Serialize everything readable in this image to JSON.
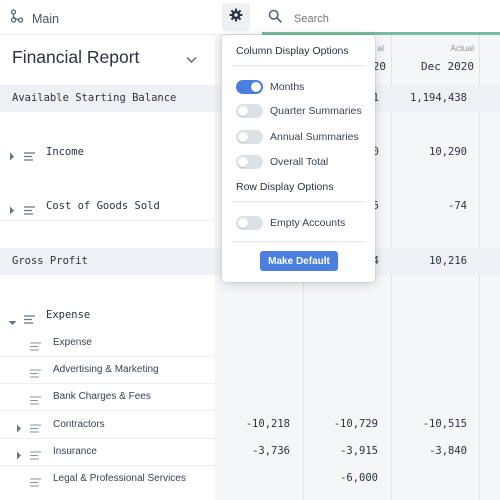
{
  "topbar": {
    "crumb_label": "Main",
    "search_placeholder": "Search",
    "accent": "#79bba0"
  },
  "report": {
    "title": "Financial Report"
  },
  "columns": [
    {
      "top": "al",
      "main": "20"
    },
    {
      "top": "Actual",
      "main": "Dec 2020"
    }
  ],
  "rows": {
    "available": {
      "label": "Available Starting Balance",
      "col_partial": "1",
      "col_last": "1,194,438"
    },
    "income": {
      "label": "Income",
      "col_partial": "0",
      "col_last": "10,290"
    },
    "cogs": {
      "label": "Cost of Goods Sold",
      "col_partial": "5",
      "col_last": "-74"
    },
    "gross": {
      "label": "Gross Profit",
      "col_partial": "4",
      "col_last": "10,216"
    },
    "expense_group": {
      "label": "Expense"
    },
    "expense": {
      "label": "Expense"
    },
    "advertising": {
      "label": "Advertising & Marketing"
    },
    "bank": {
      "label": "Bank Charges & Fees"
    },
    "contractors": {
      "label": "Contractors",
      "c1": "-10,218",
      "c2": "-10,729",
      "c3": "-10,515"
    },
    "insurance": {
      "label": "Insurance",
      "c1": "-3,736",
      "c2": "-3,915",
      "c3": "-3,840"
    },
    "legal": {
      "label": "Legal & Professional Services",
      "c2": "-6,000"
    }
  },
  "popover": {
    "column_heading": "Column Display Options",
    "row_heading": "Row Display Options",
    "toggles": [
      {
        "label": "Months",
        "on": true
      },
      {
        "label": "Quarter Summaries",
        "on": false
      },
      {
        "label": "Annual Summaries",
        "on": false
      },
      {
        "label": "Overall Total",
        "on": false
      }
    ],
    "row_toggles": [
      {
        "label": "Empty Accounts",
        "on": false
      }
    ],
    "button_label": "Make Default",
    "accent": "#4a7fe0"
  }
}
